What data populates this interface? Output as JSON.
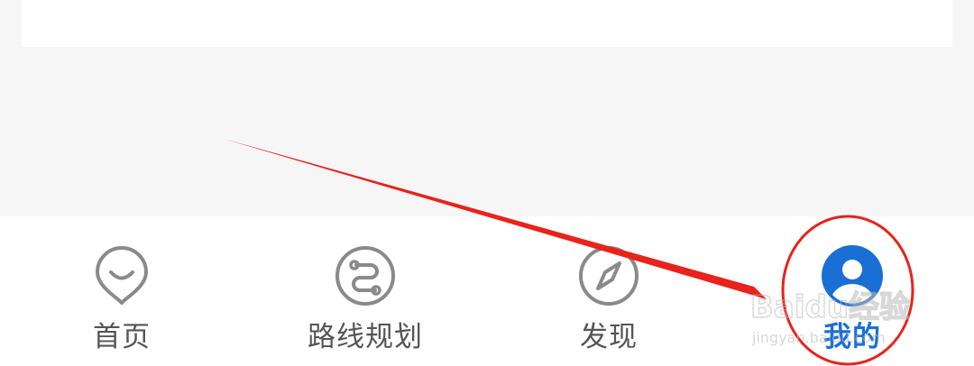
{
  "tabs": [
    {
      "label": "首页",
      "icon": "location-smile-icon"
    },
    {
      "label": "路线规划",
      "icon": "route-icon"
    },
    {
      "label": "发现",
      "icon": "compass-icon"
    },
    {
      "label": "我的",
      "icon": "user-icon",
      "active": true
    }
  ],
  "watermark": {
    "brand": "Baidu经验",
    "url": "jingyan.baidu.com"
  },
  "colors": {
    "background": "#f6f6f6",
    "card": "#ffffff",
    "icon_gray": "#8a8a8a",
    "label_gray": "#555555",
    "active_blue": "#1a6fd4",
    "annotation_red": "#e8231b"
  }
}
